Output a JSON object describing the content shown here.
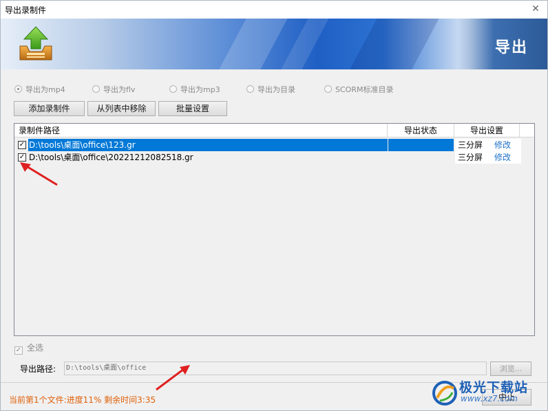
{
  "window": {
    "title": "导出录制件",
    "close_glyph": "✕"
  },
  "banner": {
    "heading": "导出",
    "logo_icon": "export-tray-icon",
    "brand_color": "#1f5fc4"
  },
  "export_options": [
    {
      "label": "导出为mp4",
      "selected": true
    },
    {
      "label": "导出为flv",
      "selected": false
    },
    {
      "label": "导出为mp3",
      "selected": false
    },
    {
      "label": "导出为目录",
      "selected": false
    },
    {
      "label": "SCORM标准目录",
      "selected": false
    }
  ],
  "toolbar": {
    "add_label": "添加录制件",
    "remove_label": "从列表中移除",
    "batch_label": "批量设置"
  },
  "list": {
    "columns": [
      "录制件路径",
      "导出状态",
      "导出设置"
    ],
    "rows": [
      {
        "checked": true,
        "path": "D:\\tools\\桌面\\office\\123.gr",
        "status": "",
        "mode": "三分屏",
        "action": "修改"
      },
      {
        "checked": true,
        "path": "D:\\tools\\桌面\\office\\20221212082518.gr",
        "status": "",
        "mode": "三分屏",
        "action": "修改"
      }
    ]
  },
  "select_all": {
    "label": "全选",
    "checked": true
  },
  "export_path": {
    "label": "导出路径:",
    "value": "D:\\tools\\桌面\\office",
    "browse_label": "浏览..."
  },
  "status": {
    "text": "当前第1个文件:进度11% 剩余时间3:35",
    "color": "#e0600a"
  },
  "stop_label": "中止",
  "watermark": {
    "title": "极光下载站",
    "url": "www.xz7.com"
  },
  "annotation_color": "#e02020"
}
